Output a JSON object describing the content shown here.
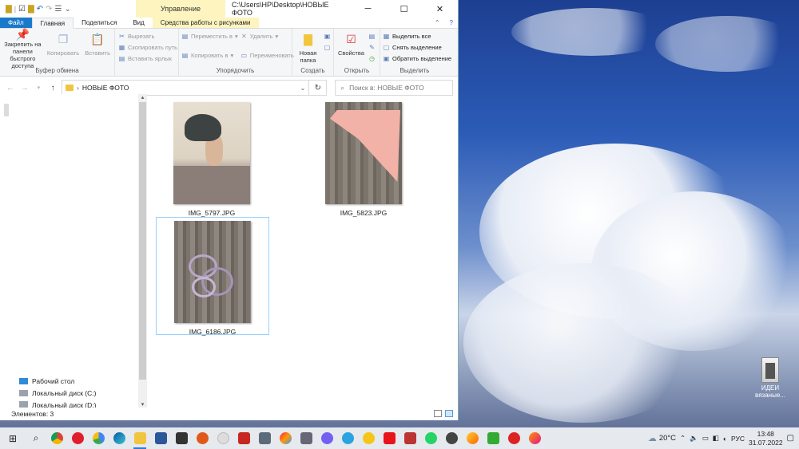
{
  "window": {
    "context_tab_title": "Управление",
    "path_title": "C:\\Users\\HP\\Desktop\\НОВЫЕ ФОТО",
    "minimize": "─",
    "maximize": "☐",
    "close": "✕"
  },
  "quick_access_toolbar": [
    "folder-icon",
    "check-icon",
    "new-folder-icon",
    "undo-icon",
    "redo-icon",
    "properties-icon",
    "dropdown-icon"
  ],
  "ribbon_tabs": [
    {
      "label": "Файл"
    },
    {
      "label": "Главная"
    },
    {
      "label": "Поделиться"
    },
    {
      "label": "Вид"
    },
    {
      "label": "Средства работы с рисунками"
    }
  ],
  "ribbon": {
    "clipboard": {
      "label": "Буфер обмена",
      "pin": "Закрепить на панели быстрого доступа",
      "copy": "Копировать",
      "paste": "Вставить",
      "cut": "Вырезать",
      "copy_path": "Скопировать путь",
      "paste_shortcut": "Вставить ярлык"
    },
    "organize": {
      "label": "Упорядочить",
      "move_to": "Переместить в",
      "copy_to": "Копировать в",
      "delete": "Удалить",
      "rename": "Переименовать"
    },
    "create": {
      "label": "Создать",
      "new_folder": "Новая папка"
    },
    "open": {
      "label": "Открыть",
      "properties": "Свойства"
    },
    "select": {
      "label": "Выделить",
      "select_all": "Выделить все",
      "select_none": "Снять выделение",
      "invert": "Обратить выделение"
    }
  },
  "address": {
    "crumb": "НОВЫЕ ФОТО",
    "search_placeholder": "Поиск в: НОВЫЕ ФОТО"
  },
  "nav_pane": {
    "items": [
      {
        "label": "Рабочий стол"
      },
      {
        "label": "Локальный диск (C:)"
      },
      {
        "label": "Локальный диск (D:)"
      }
    ]
  },
  "files": [
    {
      "name": "IMG_5797.JPG",
      "selected": false
    },
    {
      "name": "IMG_5823.JPG",
      "selected": false
    },
    {
      "name": "IMG_6186.JPG",
      "selected": true
    }
  ],
  "status": {
    "count": "Элементов: 3"
  },
  "desktop_icon": {
    "label": "ИДЕИ вязаные..."
  },
  "taskbar": {
    "weather": "20°C",
    "lang": "РУС",
    "time": "13:48",
    "date": "31.07.2022"
  }
}
